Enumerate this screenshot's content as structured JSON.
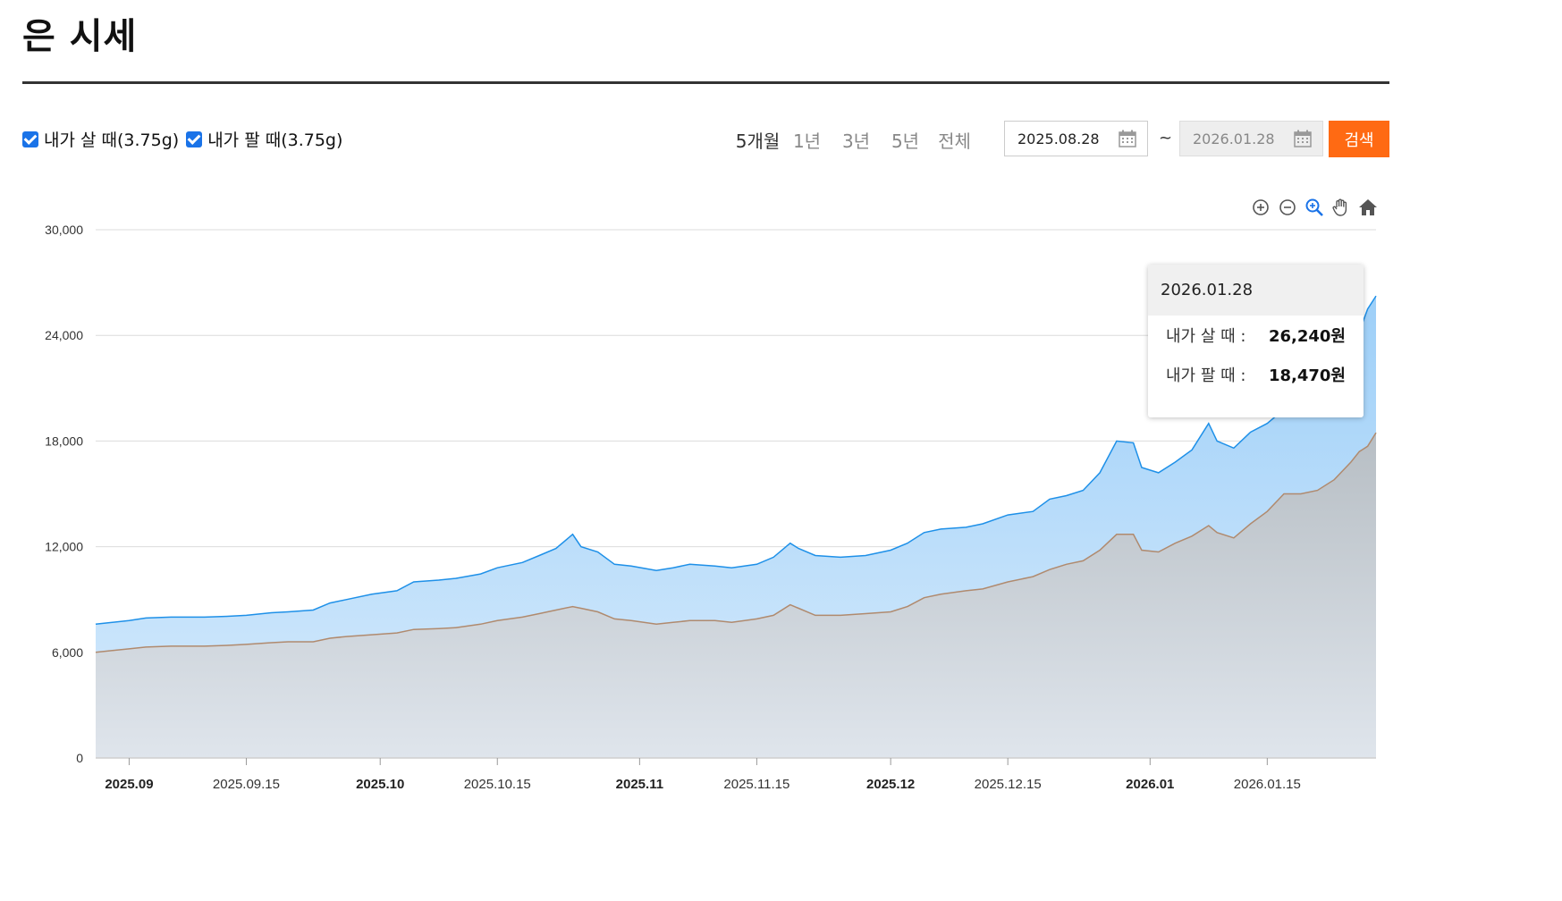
{
  "page": {
    "title": "은 시세"
  },
  "legend": {
    "buy_label": "내가 살 때(3.75g)",
    "sell_label": "내가 팔 때(3.75g)"
  },
  "periods": [
    "5개월",
    "1년",
    "3년",
    "5년",
    "전체"
  ],
  "active_period": "5개월",
  "date_range": {
    "from": "2025.08.28",
    "tilde": "~",
    "to": "2026.01.28"
  },
  "search_label": "검색",
  "toolbar_icons": [
    "zoom-in-icon",
    "zoom-out-icon",
    "magnify-icon",
    "pan-hand-icon",
    "home-icon"
  ],
  "tooltip": {
    "date": "2026.01.28",
    "buy_label": "내가 살 때 :",
    "buy_value": "26,240원",
    "sell_label": "내가 팔 때 :",
    "sell_value": "18,470원"
  },
  "colors": {
    "buy": "#1e90e8",
    "sell": "#b08a6e",
    "accent": "#ff6a13",
    "checkbox": "#1a73e8"
  },
  "chart_data": {
    "type": "area",
    "ylim": [
      0,
      30000
    ],
    "yticks": [
      0,
      6000,
      12000,
      18000,
      24000,
      30000
    ],
    "ytick_labels": [
      "0",
      "6,000",
      "12,000",
      "18,000",
      "24,000",
      "30,000"
    ],
    "xlim": [
      "2025-08-28",
      "2026-01-28"
    ],
    "xticks": [
      {
        "date": "2025-09-01",
        "label": "2025.09",
        "bold": true
      },
      {
        "date": "2025-09-15",
        "label": "2025.09.15",
        "bold": false
      },
      {
        "date": "2025-10-01",
        "label": "2025.10",
        "bold": true
      },
      {
        "date": "2025-10-15",
        "label": "2025.10.15",
        "bold": false
      },
      {
        "date": "2025-11-01",
        "label": "2025.11",
        "bold": true
      },
      {
        "date": "2025-11-15",
        "label": "2025.11.15",
        "bold": false
      },
      {
        "date": "2025-12-01",
        "label": "2025.12",
        "bold": true
      },
      {
        "date": "2025-12-15",
        "label": "2025.12.15",
        "bold": false
      },
      {
        "date": "2026-01-01",
        "label": "2026.01",
        "bold": true
      },
      {
        "date": "2026-01-15",
        "label": "2026.01.15",
        "bold": false
      }
    ],
    "grid": true,
    "series": [
      {
        "name": "내가 살 때",
        "points": [
          [
            "2025-08-28",
            7600
          ],
          [
            "2025-08-30",
            7700
          ],
          [
            "2025-09-01",
            7800
          ],
          [
            "2025-09-03",
            7950
          ],
          [
            "2025-09-06",
            8000
          ],
          [
            "2025-09-10",
            8000
          ],
          [
            "2025-09-13",
            8050
          ],
          [
            "2025-09-15",
            8100
          ],
          [
            "2025-09-18",
            8250
          ],
          [
            "2025-09-20",
            8300
          ],
          [
            "2025-09-23",
            8400
          ],
          [
            "2025-09-25",
            8800
          ],
          [
            "2025-09-27",
            9000
          ],
          [
            "2025-09-30",
            9300
          ],
          [
            "2025-10-03",
            9500
          ],
          [
            "2025-10-05",
            10000
          ],
          [
            "2025-10-08",
            10100
          ],
          [
            "2025-10-10",
            10200
          ],
          [
            "2025-10-13",
            10450
          ],
          [
            "2025-10-15",
            10800
          ],
          [
            "2025-10-18",
            11100
          ],
          [
            "2025-10-20",
            11500
          ],
          [
            "2025-10-22",
            11900
          ],
          [
            "2025-10-24",
            12700
          ],
          [
            "2025-10-25",
            12000
          ],
          [
            "2025-10-27",
            11700
          ],
          [
            "2025-10-29",
            11000
          ],
          [
            "2025-10-31",
            10900
          ],
          [
            "2025-11-03",
            10650
          ],
          [
            "2025-11-05",
            10800
          ],
          [
            "2025-11-07",
            11000
          ],
          [
            "2025-11-10",
            10900
          ],
          [
            "2025-11-12",
            10800
          ],
          [
            "2025-11-15",
            11000
          ],
          [
            "2025-11-17",
            11400
          ],
          [
            "2025-11-19",
            12200
          ],
          [
            "2025-11-20",
            11900
          ],
          [
            "2025-11-22",
            11500
          ],
          [
            "2025-11-25",
            11400
          ],
          [
            "2025-11-28",
            11500
          ],
          [
            "2025-12-01",
            11800
          ],
          [
            "2025-12-03",
            12200
          ],
          [
            "2025-12-05",
            12800
          ],
          [
            "2025-12-07",
            13000
          ],
          [
            "2025-12-10",
            13100
          ],
          [
            "2025-12-12",
            13300
          ],
          [
            "2025-12-15",
            13800
          ],
          [
            "2025-12-18",
            14000
          ],
          [
            "2025-12-20",
            14700
          ],
          [
            "2025-12-22",
            14900
          ],
          [
            "2025-12-24",
            15200
          ],
          [
            "2025-12-26",
            16200
          ],
          [
            "2025-12-28",
            18000
          ],
          [
            "2025-12-30",
            17900
          ],
          [
            "2025-12-31",
            16500
          ],
          [
            "2026-01-02",
            16200
          ],
          [
            "2026-01-04",
            16800
          ],
          [
            "2026-01-06",
            17500
          ],
          [
            "2026-01-08",
            19000
          ],
          [
            "2026-01-09",
            18000
          ],
          [
            "2026-01-11",
            17600
          ],
          [
            "2026-01-13",
            18500
          ],
          [
            "2026-01-15",
            19000
          ],
          [
            "2026-01-17",
            19800
          ],
          [
            "2026-01-19",
            20800
          ],
          [
            "2026-01-21",
            21800
          ],
          [
            "2026-01-23",
            23000
          ],
          [
            "2026-01-25",
            24500
          ],
          [
            "2026-01-26",
            24200
          ],
          [
            "2026-01-27",
            25500
          ],
          [
            "2026-01-28",
            26240
          ]
        ]
      },
      {
        "name": "내가 팔 때",
        "points": [
          [
            "2025-08-28",
            6000
          ],
          [
            "2025-08-30",
            6100
          ],
          [
            "2025-09-01",
            6200
          ],
          [
            "2025-09-03",
            6300
          ],
          [
            "2025-09-06",
            6350
          ],
          [
            "2025-09-10",
            6350
          ],
          [
            "2025-09-13",
            6400
          ],
          [
            "2025-09-15",
            6450
          ],
          [
            "2025-09-18",
            6550
          ],
          [
            "2025-09-20",
            6600
          ],
          [
            "2025-09-23",
            6600
          ],
          [
            "2025-09-25",
            6800
          ],
          [
            "2025-09-27",
            6900
          ],
          [
            "2025-09-30",
            7000
          ],
          [
            "2025-10-03",
            7100
          ],
          [
            "2025-10-05",
            7300
          ],
          [
            "2025-10-08",
            7350
          ],
          [
            "2025-10-10",
            7400
          ],
          [
            "2025-10-13",
            7600
          ],
          [
            "2025-10-15",
            7800
          ],
          [
            "2025-10-18",
            8000
          ],
          [
            "2025-10-20",
            8200
          ],
          [
            "2025-10-22",
            8400
          ],
          [
            "2025-10-24",
            8600
          ],
          [
            "2025-10-25",
            8500
          ],
          [
            "2025-10-27",
            8300
          ],
          [
            "2025-10-29",
            7900
          ],
          [
            "2025-10-31",
            7800
          ],
          [
            "2025-11-03",
            7600
          ],
          [
            "2025-11-05",
            7700
          ],
          [
            "2025-11-07",
            7800
          ],
          [
            "2025-11-10",
            7800
          ],
          [
            "2025-11-12",
            7700
          ],
          [
            "2025-11-15",
            7900
          ],
          [
            "2025-11-17",
            8100
          ],
          [
            "2025-11-19",
            8700
          ],
          [
            "2025-11-20",
            8500
          ],
          [
            "2025-11-22",
            8100
          ],
          [
            "2025-11-25",
            8100
          ],
          [
            "2025-11-28",
            8200
          ],
          [
            "2025-12-01",
            8300
          ],
          [
            "2025-12-03",
            8600
          ],
          [
            "2025-12-05",
            9100
          ],
          [
            "2025-12-07",
            9300
          ],
          [
            "2025-12-10",
            9500
          ],
          [
            "2025-12-12",
            9600
          ],
          [
            "2025-12-15",
            10000
          ],
          [
            "2025-12-18",
            10300
          ],
          [
            "2025-12-20",
            10700
          ],
          [
            "2025-12-22",
            11000
          ],
          [
            "2025-12-24",
            11200
          ],
          [
            "2025-12-26",
            11800
          ],
          [
            "2025-12-28",
            12700
          ],
          [
            "2025-12-30",
            12700
          ],
          [
            "2025-12-31",
            11800
          ],
          [
            "2026-01-02",
            11700
          ],
          [
            "2026-01-04",
            12200
          ],
          [
            "2026-01-06",
            12600
          ],
          [
            "2026-01-08",
            13200
          ],
          [
            "2026-01-09",
            12800
          ],
          [
            "2026-01-11",
            12500
          ],
          [
            "2026-01-13",
            13300
          ],
          [
            "2026-01-15",
            14000
          ],
          [
            "2026-01-17",
            15000
          ],
          [
            "2026-01-19",
            15000
          ],
          [
            "2026-01-21",
            15200
          ],
          [
            "2026-01-23",
            15800
          ],
          [
            "2026-01-25",
            16800
          ],
          [
            "2026-01-26",
            17400
          ],
          [
            "2026-01-27",
            17700
          ],
          [
            "2026-01-28",
            18470
          ]
        ]
      }
    ]
  }
}
